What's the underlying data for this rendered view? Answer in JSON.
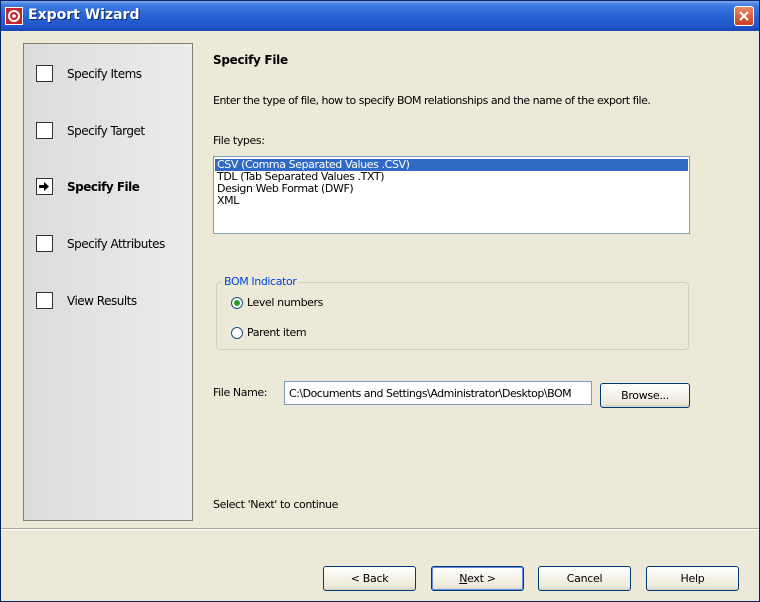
{
  "window": {
    "title": "Export Wizard"
  },
  "steps": [
    {
      "label": "Specify Items",
      "state": "pending"
    },
    {
      "label": "Specify Target",
      "state": "pending"
    },
    {
      "label": "Specify File",
      "state": "current"
    },
    {
      "label": "Specify Attributes",
      "state": "pending"
    },
    {
      "label": "View Results",
      "state": "pending"
    }
  ],
  "main": {
    "heading": "Specify File",
    "description": "Enter the type of file, how to specify BOM relationships and the name of the export file.",
    "file_types_label": "File types:",
    "file_types": [
      "CSV (Comma Separated Values .CSV)",
      "TDL (Tab Separated Values .TXT)",
      "Design Web Format (DWF)",
      "XML"
    ],
    "selected_file_type": "CSV (Comma Separated Values .CSV)",
    "bom_indicator": {
      "legend": "BOM Indicator",
      "options": [
        "Level numbers",
        "Parent item"
      ],
      "selected": "Level numbers"
    },
    "file_name_label": "File Name:",
    "file_name_value": "C:\\Documents and Settings\\Administrator\\Desktop\\BOM",
    "browse_label": "Browse...",
    "continue_text": "Select 'Next' to continue"
  },
  "footer": {
    "back_label": "< Back",
    "next_prefix": "",
    "next_mnemonic": "N",
    "next_suffix": "ext >",
    "cancel_label": "Cancel",
    "help_label": "Help"
  },
  "colors": {
    "titlebar": "#2a63d6",
    "selection": "#316ac5",
    "group_legend": "#0046d5",
    "radio_dot": "#21a121",
    "close_button": "#c9401f"
  }
}
